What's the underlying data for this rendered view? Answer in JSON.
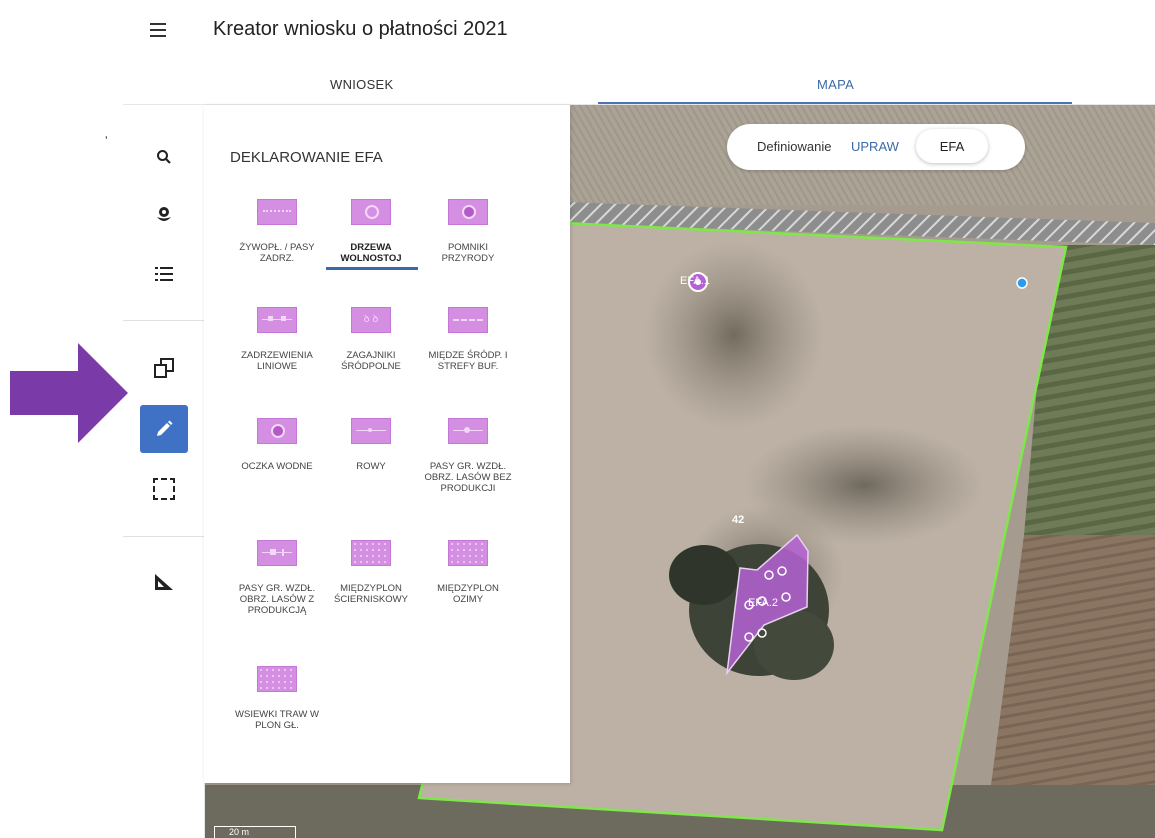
{
  "header": {
    "title": "Kreator wniosku o płatności 2021",
    "tabs": [
      {
        "label": "WNIOSEK"
      },
      {
        "label": "MAPA"
      }
    ]
  },
  "sidebar": {
    "tools": [
      "search-icon",
      "flower-icon",
      "list-icon",
      "copy-icon",
      "pencil-icon",
      "select-area-icon",
      "ruler-icon"
    ]
  },
  "panel": {
    "title": "DEKLAROWANIE EFA",
    "items": [
      {
        "label": "ŻYWOPŁ. / PASY ZADRZ.",
        "icon": "hedge-icon"
      },
      {
        "label": "DRZEWA WOLNOSTOJ",
        "icon": "tree-icon",
        "selected": true
      },
      {
        "label": "POMNIKI PRZYRODY",
        "icon": "monument-icon"
      },
      {
        "label": "ZADRZEWIENIA LINIOWE",
        "icon": "tree-line-icon"
      },
      {
        "label": "ZAGAJNIKI ŚRÓDPOLNE",
        "icon": "grove-icon"
      },
      {
        "label": "MIĘDZE ŚRÓDP. I STREFY BUF.",
        "icon": "balk-icon"
      },
      {
        "label": "OCZKA WODNE",
        "icon": "pond-icon"
      },
      {
        "label": "ROWY",
        "icon": "ditch-icon"
      },
      {
        "label": "PASY GR. WZDŁ. OBRZ. LASÓW BEZ PRODUKCJI",
        "icon": "forest-strip-icon"
      },
      {
        "label": "PASY GR. WZDŁ. OBRZ. LASÓW Z PRODUKCJĄ",
        "icon": "forest-strip-production-icon"
      },
      {
        "label": "MIĘDZYPLON ŚCIERNISKOWY",
        "icon": "catch-crop-icon"
      },
      {
        "label": "MIĘDZYPLON OZIMY",
        "icon": "winter-catch-crop-icon"
      },
      {
        "label": "WSIEWKI TRAW W PLON GŁ.",
        "icon": "undersown-grass-icon"
      }
    ]
  },
  "map": {
    "toggle_label": "Definiowanie",
    "toggle_upraw": "UPRAW",
    "toggle_efa": "EFA",
    "labels": {
      "efa1": "EFA.1",
      "parcel_number": "42",
      "efa2": "EFA.2"
    },
    "scale": "20 m"
  },
  "colors": {
    "accent": "#3c6aa8",
    "efa_purple": "#d58fe2",
    "parcel_outline": "#7ee84a",
    "arrow": "#7a3aa8"
  }
}
